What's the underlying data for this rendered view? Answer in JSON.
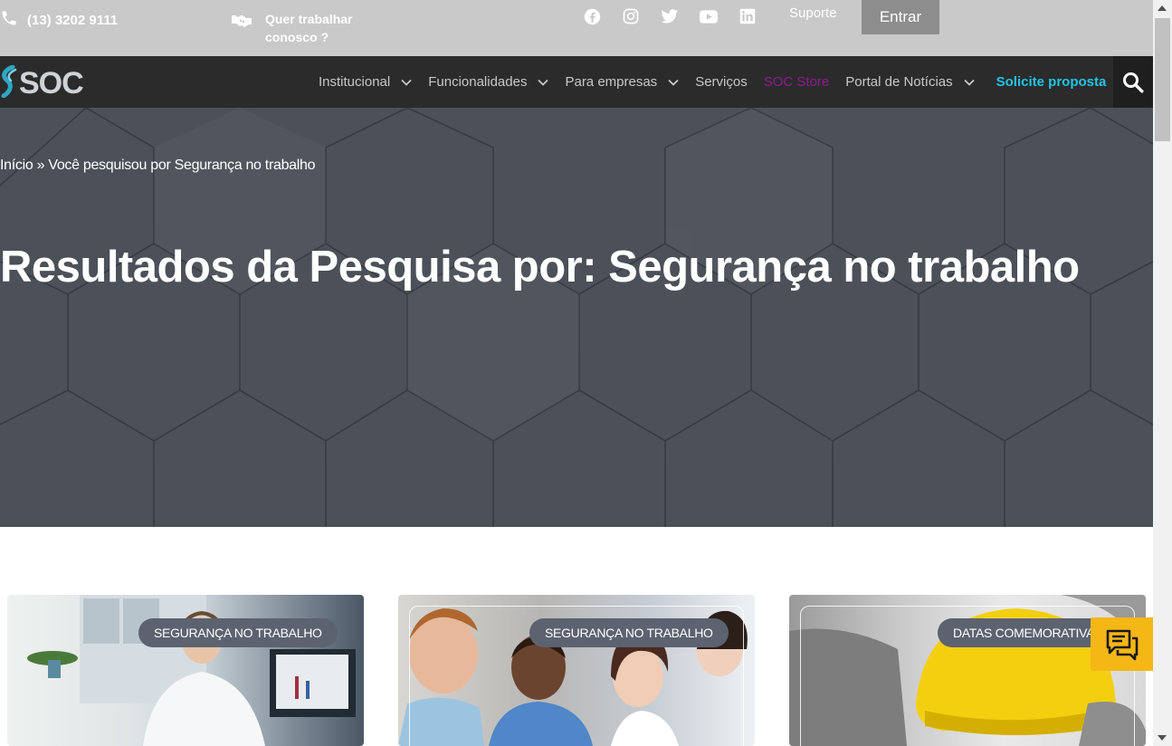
{
  "topbar": {
    "phone": "(13) 3202 9111",
    "work_line1": "Quer trabalhar",
    "work_line2": "conosco ?",
    "suporte": "Suporte",
    "entrar": "Entrar",
    "socials": [
      "facebook-icon",
      "instagram-icon",
      "twitter-icon",
      "youtube-icon",
      "linkedin-icon"
    ]
  },
  "nav": {
    "logo_text": "SOC",
    "items": [
      {
        "label": "Institucional",
        "dropdown": true
      },
      {
        "label": "Funcionalidades",
        "dropdown": true
      },
      {
        "label": "Para empresas",
        "dropdown": true
      },
      {
        "label": "Serviços",
        "dropdown": false
      },
      {
        "label": "SOC Store",
        "dropdown": false
      },
      {
        "label": "Portal de Notícias",
        "dropdown": true
      },
      {
        "label": "Solicite proposta",
        "dropdown": false
      }
    ]
  },
  "hero": {
    "breadcrumb": "Início » Você pesquisou por Segurança no trabalho",
    "title": "Resultados da Pesquisa por: Segurança no trabalho"
  },
  "cards": [
    {
      "category": "SEGURANÇA NO TRABALHO"
    },
    {
      "category": "SEGURANÇA NO TRABALHO"
    },
    {
      "category": "DATAS COMEMORATIVAS"
    }
  ],
  "colors": {
    "topbar_bg": "#c9c9c9",
    "nav_bg": "#2b2b2b",
    "store": "#8e1b8e",
    "proposta": "#22c5e6",
    "hero_bg": "#4b5059",
    "chat_bg": "#f4b715"
  }
}
